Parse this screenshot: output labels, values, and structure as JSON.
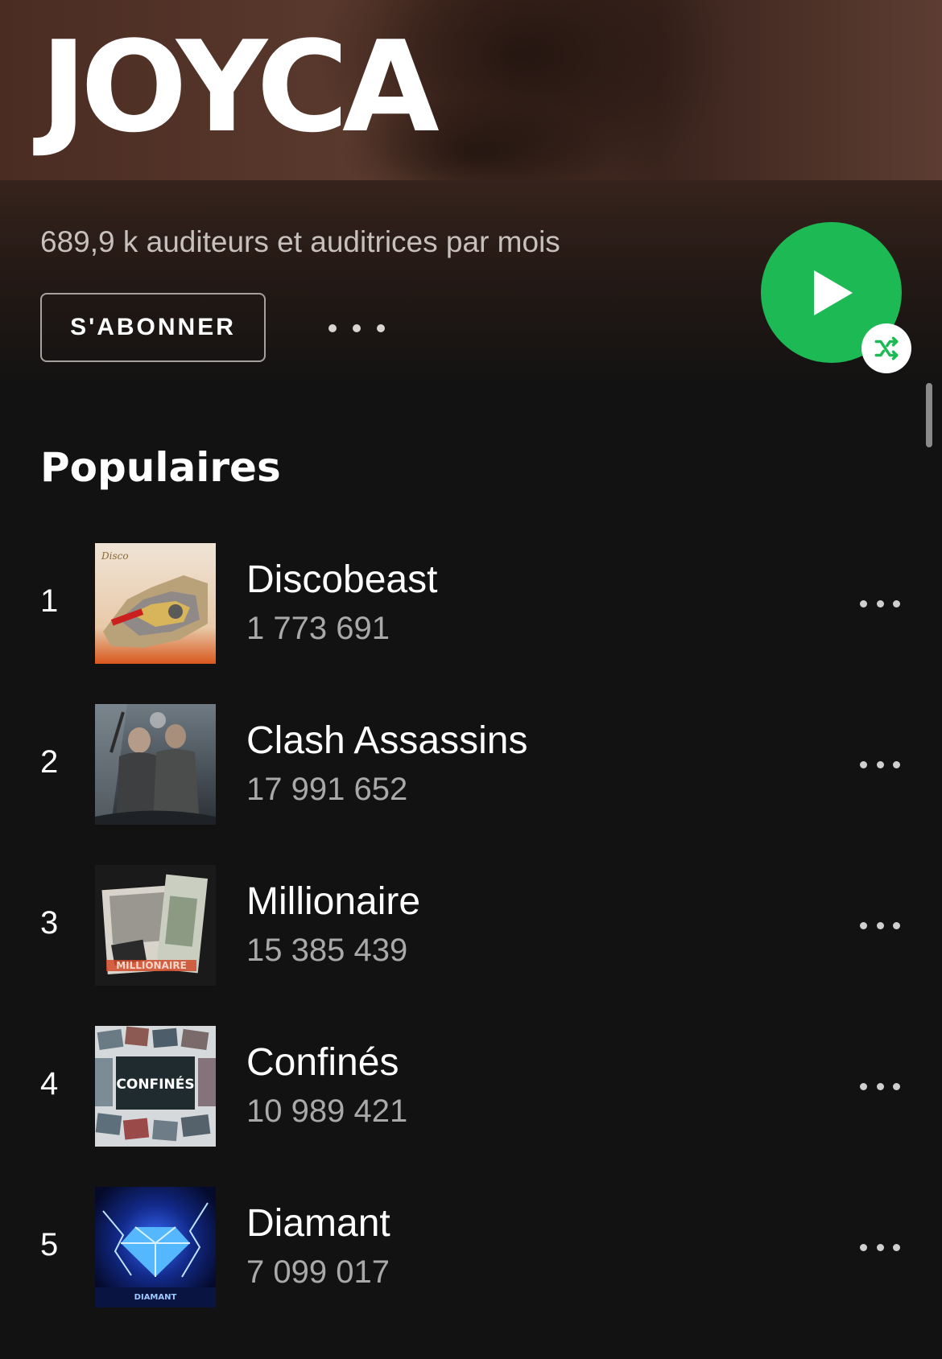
{
  "artist": {
    "name": "JOYCA",
    "monthly_listeners": "689,9 k auditeurs et auditrices par mois"
  },
  "actions": {
    "follow_label": "S'ABONNER",
    "more_icon": "more-horizontal-icon",
    "play_icon": "play-icon",
    "shuffle_icon": "shuffle-icon"
  },
  "colors": {
    "accent": "#1db954",
    "background": "#121212",
    "hero": "#5b3a2e"
  },
  "popular": {
    "title": "Populaires",
    "tracks": [
      {
        "rank": "1",
        "title": "Discobeast",
        "plays": "1 773 691"
      },
      {
        "rank": "2",
        "title": "Clash Assassins",
        "plays": "17 991 652"
      },
      {
        "rank": "3",
        "title": "Millionaire",
        "plays": "15 385 439"
      },
      {
        "rank": "4",
        "title": "Confinés",
        "plays": "10 989 421"
      },
      {
        "rank": "5",
        "title": "Diamant",
        "plays": "7 099 017"
      }
    ],
    "cover_texts": {
      "confines": "CONFINÉS",
      "millionaire": "MILLIONAIRE",
      "diamant": "DIAMANT"
    }
  }
}
